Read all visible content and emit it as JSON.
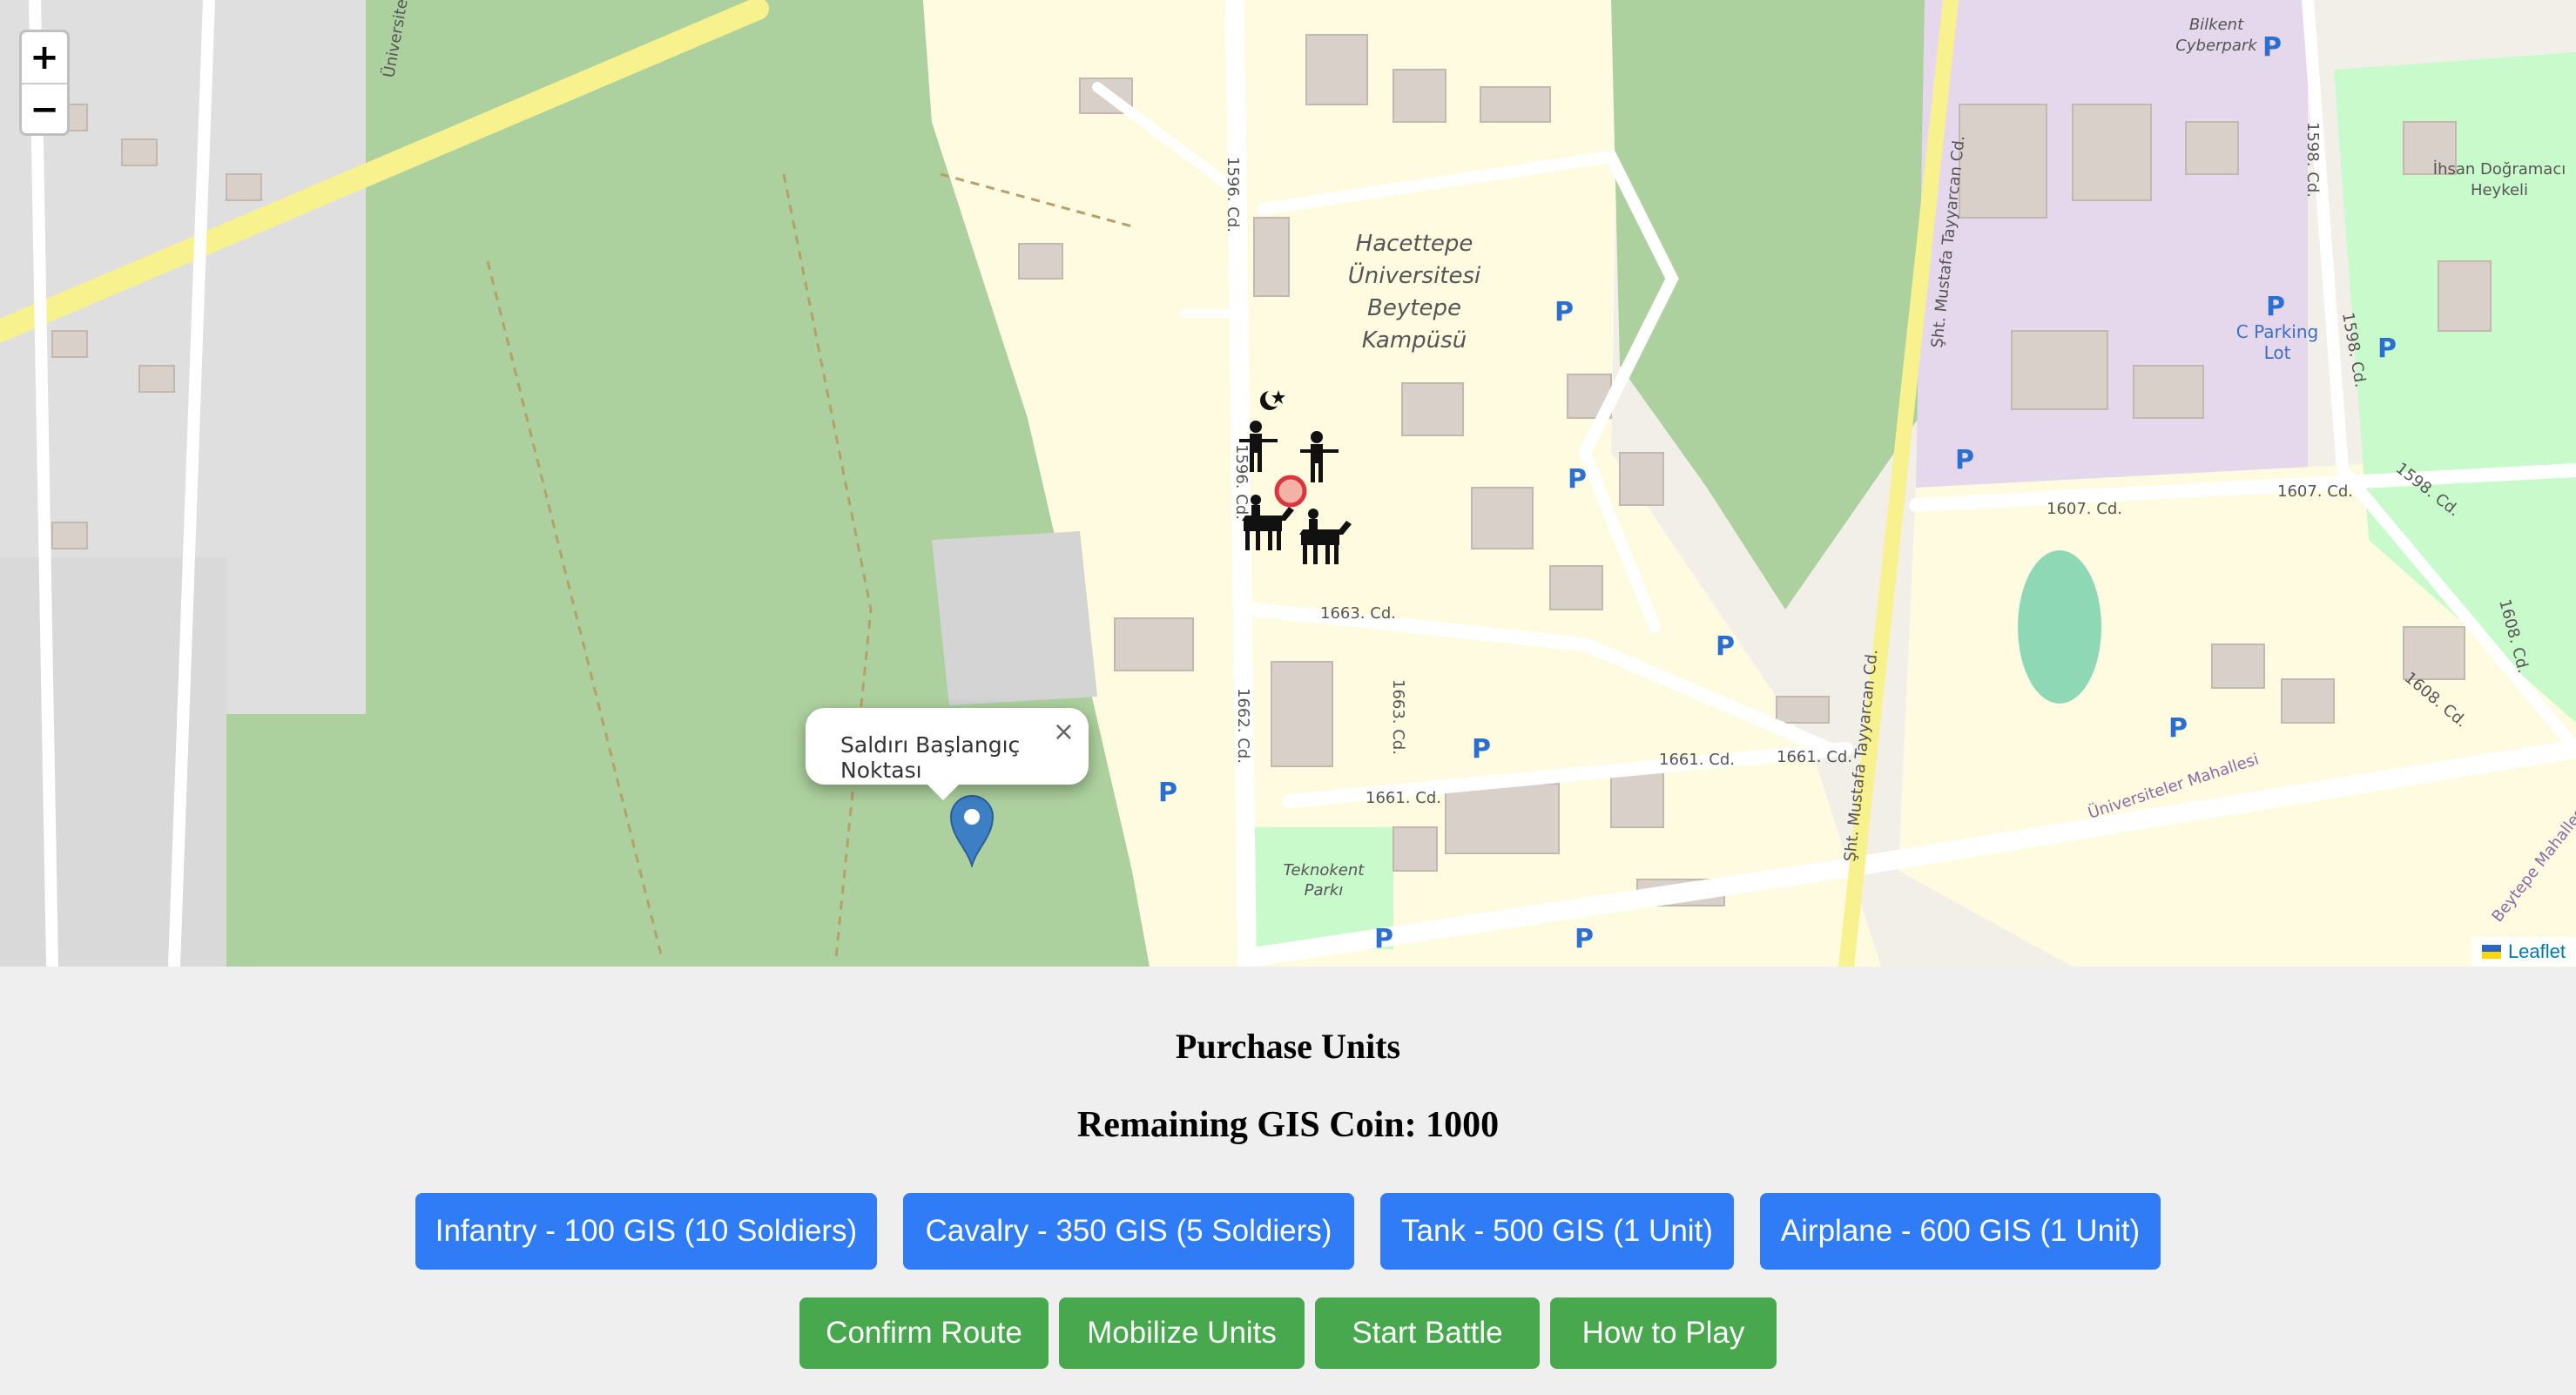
{
  "map": {
    "zoom_in_label": "+",
    "zoom_out_label": "−",
    "popup": {
      "text": "Saldırı Başlangıç Noktası",
      "close_label": "×"
    },
    "attribution": "Leaflet",
    "labels": {
      "campus": [
        "Hacettepe",
        "Üniversitesi",
        "Beytepe",
        "Kampüsü"
      ],
      "bilkent": [
        "Bilkent",
        "Cyberpark"
      ],
      "statue": [
        "İhsan Doğramacı",
        "Heykeli"
      ],
      "parking": [
        "C Parking",
        "Lot"
      ],
      "teknokent": [
        "Teknokent",
        "Parkı"
      ],
      "street_tayyarcan": "Şht. Mustafa Tayyarcan Cd.",
      "street_1596": "1596. Cd.",
      "street_1663": "1663. Cd.",
      "street_1661": "1661. Cd.",
      "street_1662": "1662. Cd.",
      "street_1607": "1607. Cd.",
      "street_1598": "1598. Cd.",
      "street_1608": "1608. Cd.",
      "street_universiteler": "Üniversiteler Mahallesi",
      "street_beytepe": "Beytepe Mahallesi",
      "street_universite": "Üniversite",
      "parking_symbol": "P"
    },
    "colors": {
      "background": "#f2efe9",
      "forest": "#add19e",
      "park": "#c8facc",
      "campus": "#fffbe0",
      "commercial": "#e5d8ec",
      "building": "#d9d0c9",
      "road": "#ffffff",
      "trunk": "#f7f28e",
      "marker": "#3d7fc4",
      "target": "#d9363e"
    },
    "icons": [
      "map-pin-icon",
      "infantry-icon",
      "cavalry-icon",
      "target-circle-icon",
      "mosque-icon"
    ]
  },
  "panel": {
    "title": "Purchase Units",
    "coin_label": "Remaining GIS Coin: 1000",
    "purchase_buttons": [
      "Infantry - 100 GIS (10 Soldiers)",
      "Cavalry - 350 GIS (5 Soldiers)",
      "Tank - 500 GIS (1 Unit)",
      "Airplane - 600 GIS (1 Unit)"
    ],
    "action_buttons": [
      "Confirm Route",
      "Mobilize Units",
      "Start Battle",
      "How to Play"
    ],
    "colors": {
      "purchase": "#2f7cf6",
      "action": "#47a84e"
    }
  }
}
